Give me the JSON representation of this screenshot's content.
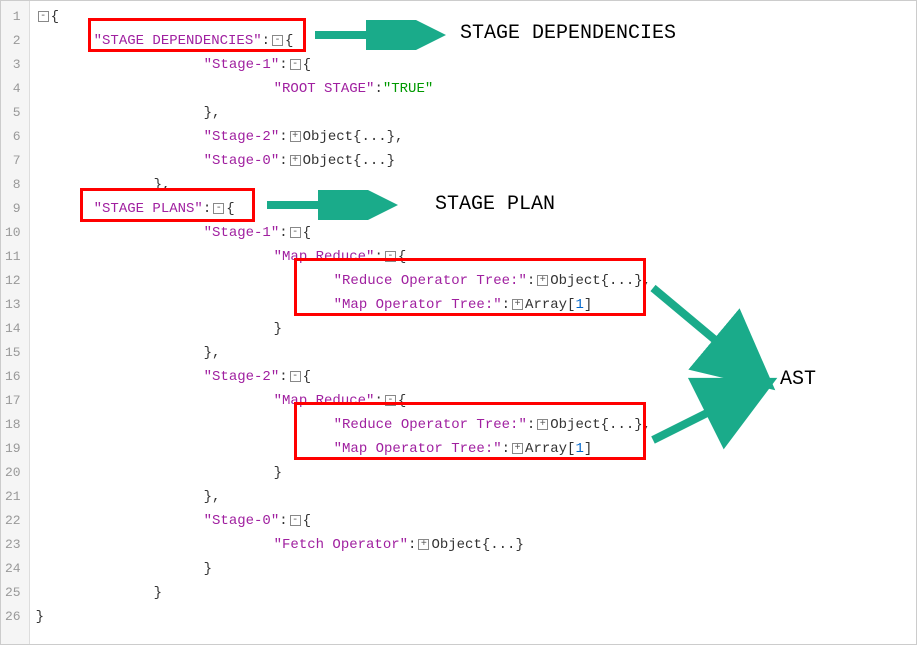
{
  "labels": {
    "stage_dependencies": "STAGE DEPENDENCIES",
    "stage_plan": "STAGE PLAN",
    "ast": "AST"
  },
  "code": {
    "l1": "{",
    "l2_key": "\"STAGE DEPENDENCIES\"",
    "l2_rest": ":",
    "l2_brace": "{",
    "l3_key": "\"Stage-1\"",
    "l3_rest": ":",
    "l3_brace": "{",
    "l4_key": "\"ROOT STAGE\"",
    "l4_colon": ":",
    "l4_val": "\"TRUE\"",
    "l5": "},",
    "l6_key": "\"Stage-2\"",
    "l6_colon": ":",
    "l6_obj": "Object{...},",
    "l7_key": "\"Stage-0\"",
    "l7_colon": ":",
    "l7_obj": "Object{...}",
    "l8": "},",
    "l9_key": "\"STAGE PLANS\"",
    "l9_colon": ":",
    "l9_brace": "{",
    "l10_key": "\"Stage-1\"",
    "l10_colon": ":",
    "l10_brace": "{",
    "l11_key": "\"Map Reduce\"",
    "l11_colon": ":",
    "l11_brace": "{",
    "l12_key": "\"Reduce Operator Tree:\"",
    "l12_colon": ":",
    "l12_obj": "Object{...},",
    "l13_key": "\"Map Operator Tree:\"",
    "l13_colon": ":",
    "l13_arr": "Array[",
    "l13_num": "1",
    "l13_close": "]",
    "l14": "}",
    "l15": "},",
    "l16_key": "\"Stage-2\"",
    "l16_colon": ":",
    "l16_brace": "{",
    "l17_key": "\"Map Reduce\"",
    "l17_colon": ":",
    "l17_brace": "{",
    "l18_key": "\"Reduce Operator Tree:\"",
    "l18_colon": ":",
    "l18_obj": "Object{...},",
    "l19_key": "\"Map Operator Tree:\"",
    "l19_colon": ":",
    "l19_arr": "Array[",
    "l19_num": "1",
    "l19_close": "]",
    "l20": "}",
    "l21": "},",
    "l22_key": "\"Stage-0\"",
    "l22_colon": ":",
    "l22_brace": "{",
    "l23_key": "\"Fetch Operator\"",
    "l23_colon": ":",
    "l23_obj": "Object{...}",
    "l24": "}",
    "l25": "}",
    "l26": "}"
  },
  "toggles": {
    "minus": "-",
    "plus": "+"
  }
}
